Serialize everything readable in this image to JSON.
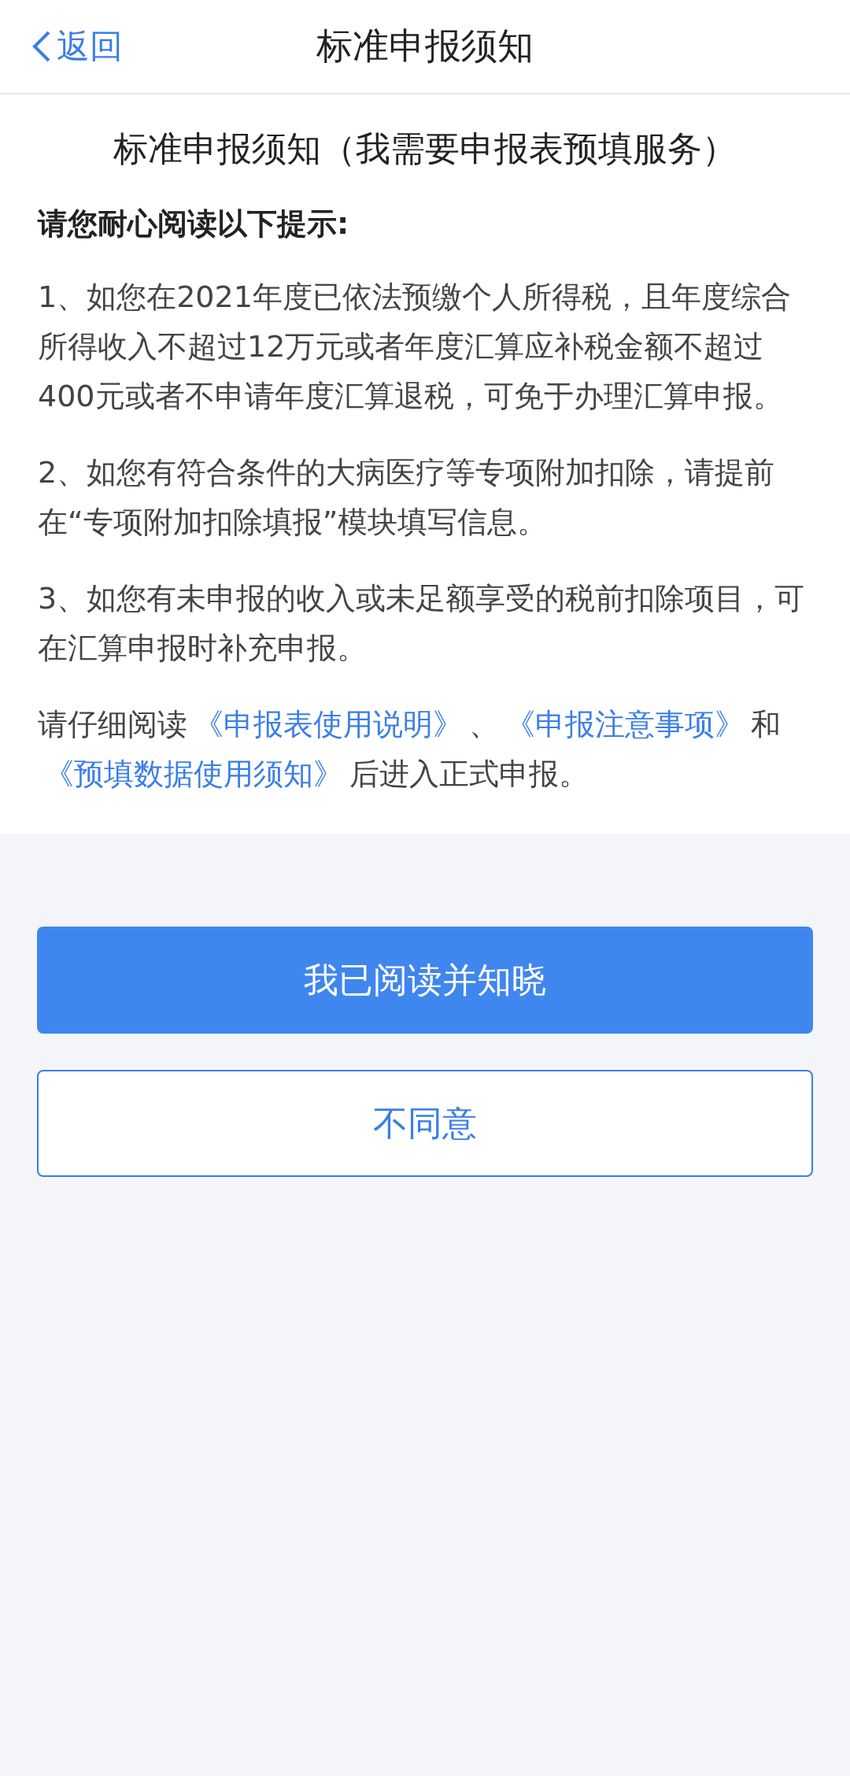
{
  "nav_bar": {
    "back_label": "返回",
    "title": "标准申报须知"
  },
  "notice": {
    "heading": "标准申报须知（我需要申报表预填服务）",
    "intro": "请您耐心阅读以下提示:",
    "items": [
      "1、如您在2021年度已依法预缴个人所得税，且年度综合所得收入不超过12万元或者年度汇算应补税金额不超过400元或者不申请年度汇算退税，可免于办理汇算申报。",
      "2、如您有符合条件的大病医疗等专项附加扣除，请提前在“专项附加扣除填报”模块填写信息。",
      "3、如您有未申报的收入或未足额享受的税前扣除项目，可在汇算申报时补充申报。"
    ],
    "closing": [
      {
        "kind": "text",
        "text": "请仔细阅读"
      },
      {
        "kind": "link",
        "text": "《申报表使用说明》"
      },
      {
        "kind": "text",
        "text": "、"
      },
      {
        "kind": "link",
        "text": "《申报注意事项》"
      },
      {
        "kind": "text",
        "text": "和"
      },
      {
        "kind": "link",
        "text": "《预填数据使用须知》"
      },
      {
        "kind": "text",
        "text": "后进入正式申报。"
      }
    ]
  },
  "buttons": [
    {
      "label": "我已阅读并知晓",
      "kind": "primary"
    },
    {
      "label": "不同意",
      "kind": "secondary"
    }
  ]
}
